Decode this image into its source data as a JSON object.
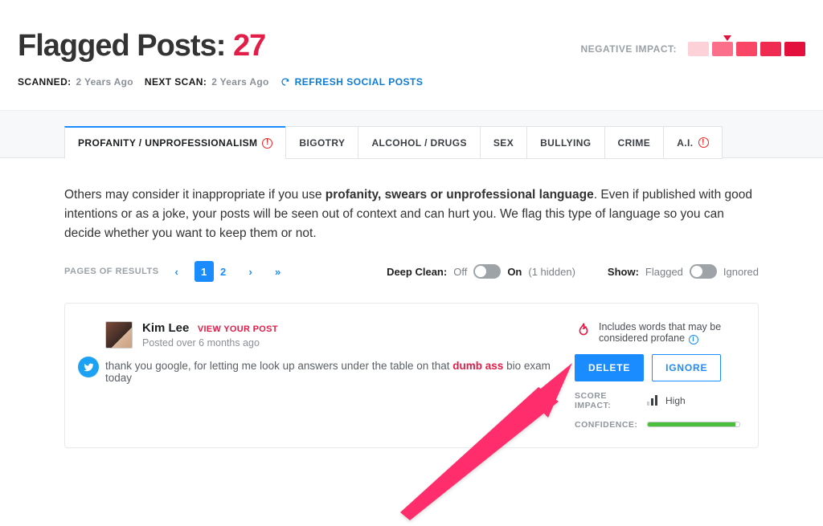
{
  "header": {
    "title_prefix": "Flagged Posts:",
    "count": "27",
    "neg_impact_label": "NEGATIVE IMPACT:"
  },
  "scan": {
    "scanned_label": "SCANNED:",
    "scanned_value": "2 Years Ago",
    "next_label": "NEXT SCAN:",
    "next_value": "2 Years Ago",
    "refresh": "REFRESH SOCIAL POSTS"
  },
  "tabs": [
    {
      "label": "PROFANITY / UNPROFESSIONALISM",
      "warn": true,
      "active": true
    },
    {
      "label": "BIGOTRY"
    },
    {
      "label": "ALCOHOL / DRUGS"
    },
    {
      "label": "SEX"
    },
    {
      "label": "BULLYING"
    },
    {
      "label": "CRIME"
    },
    {
      "label": "A.I.",
      "warn": true
    }
  ],
  "description": {
    "pre": "Others may consider it inappropriate if you use ",
    "bold": "profanity, swears or unprofessional language",
    "post": ". Even if published with good intentions or as a joke, your posts will be seen out of context and can hurt you. We flag this type of language so you can decide whether you want to keep them or not."
  },
  "pagination": {
    "label": "PAGES OF RESULTS",
    "pages": [
      "1",
      "2"
    ],
    "current": "1"
  },
  "deepclean": {
    "label": "Deep Clean:",
    "off": "Off",
    "on": "On",
    "hidden": "(1 hidden)"
  },
  "show": {
    "label": "Show:",
    "flagged": "Flagged",
    "ignored": "Ignored"
  },
  "post": {
    "name": "Kim Lee",
    "view": "View Your Post",
    "posted": "Posted over 6 months ago",
    "text_pre": "thank you google, for letting me look up answers under the table on that ",
    "flagged": "dumb ass",
    "text_post": " bio exam today",
    "reason": "Includes words that may be considered profane",
    "delete": "DELETE",
    "ignore": "IGNORE",
    "score_impact_label": "SCORE IMPACT:",
    "score_impact_value": "High",
    "confidence_label": "CONFIDENCE:"
  }
}
